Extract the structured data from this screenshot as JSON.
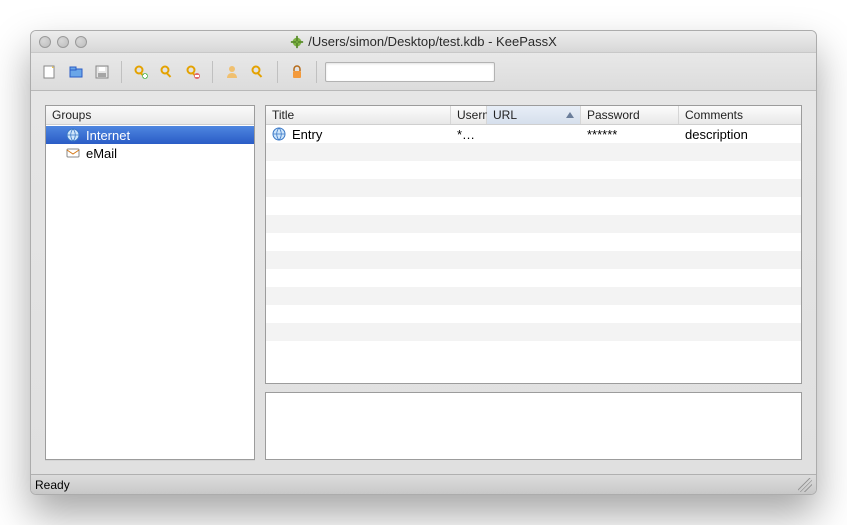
{
  "window": {
    "title": "/Users/simon/Desktop/test.kdb - KeePassX"
  },
  "toolbar": {
    "search_placeholder": ""
  },
  "groups": {
    "header": "Groups",
    "items": [
      {
        "label": "Internet",
        "icon": "globe-icon",
        "selected": true
      },
      {
        "label": "eMail",
        "icon": "mail-icon",
        "selected": false
      }
    ]
  },
  "columns": {
    "title": "Title",
    "user": "Usern",
    "url": "URL",
    "password": "Password",
    "comments": "Comments",
    "sorted": "url",
    "sort_dir": "asc"
  },
  "entries": [
    {
      "title": "Entry",
      "username": "*…",
      "url": "",
      "password": "******",
      "comments": "description"
    }
  ],
  "status": {
    "text": "Ready"
  }
}
